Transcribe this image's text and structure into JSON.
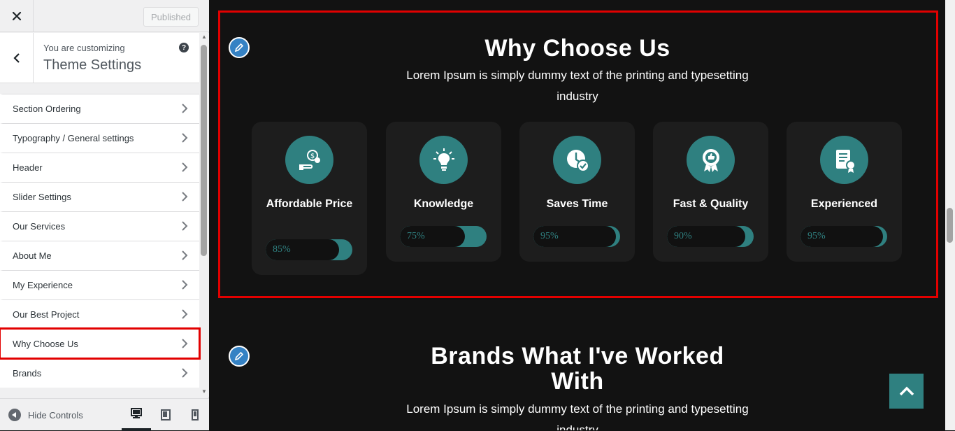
{
  "header": {
    "close_icon": "close-icon",
    "publish_label": "Published"
  },
  "info": {
    "customizing_label": "You are customizing",
    "panel_title": "Theme Settings",
    "help_glyph": "?"
  },
  "menu": [
    {
      "label": "Section Ordering"
    },
    {
      "label": "Typography / General settings"
    },
    {
      "label": "Header"
    },
    {
      "label": "Slider Settings"
    },
    {
      "label": "Our Services"
    },
    {
      "label": "About Me"
    },
    {
      "label": "My Experience"
    },
    {
      "label": "Our Best Project"
    },
    {
      "label": "Why Choose Us"
    },
    {
      "label": "Brands"
    }
  ],
  "footer": {
    "hide_controls_label": "Hide Controls"
  },
  "why_choose": {
    "title": "Why Choose Us",
    "subtitle": "Lorem Ipsum is simply dummy text of the printing and typesetting industry",
    "cards": [
      {
        "title": "Affordable Price",
        "percent_label": "85%",
        "percent": 85,
        "icon": "hand-money-icon"
      },
      {
        "title": "Knowledge",
        "percent_label": "75%",
        "percent": 75,
        "icon": "lightbulb-icon"
      },
      {
        "title": "Saves Time",
        "percent_label": "95%",
        "percent": 95,
        "icon": "clock-check-icon"
      },
      {
        "title": "Fast & Quality",
        "percent_label": "90%",
        "percent": 90,
        "icon": "badge-thumb-icon"
      },
      {
        "title": "Experienced",
        "percent_label": "95%",
        "percent": 95,
        "icon": "certificate-icon"
      }
    ]
  },
  "brands": {
    "title": "Brands What I've Worked With",
    "subtitle": "Lorem Ipsum is simply dummy text of the printing and typesetting industry"
  },
  "colors": {
    "accent": "#2f8080",
    "highlight": "#e20000",
    "edit_button": "#3582c4"
  }
}
